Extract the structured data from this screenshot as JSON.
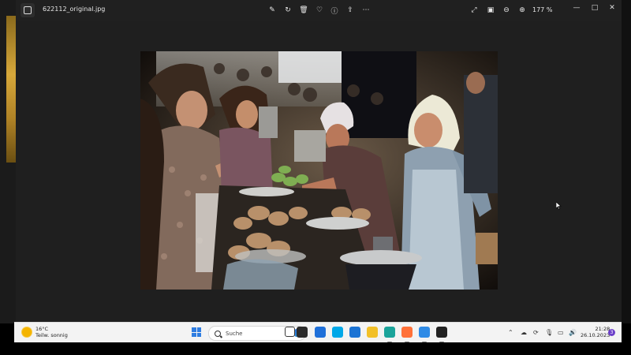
{
  "window": {
    "filename": "622112_original.jpg",
    "zoom": "177 %",
    "toolbar": [
      {
        "name": "edit-image-icon",
        "glyph": "✎"
      },
      {
        "name": "rotate-icon",
        "glyph": "↻"
      },
      {
        "name": "delete-icon",
        "glyph": "🗑"
      },
      {
        "name": "favorite-icon",
        "glyph": "♡"
      },
      {
        "name": "info-icon",
        "glyph": "ⓘ"
      },
      {
        "name": "share-icon",
        "glyph": "⇪"
      },
      {
        "name": "more-options-icon",
        "glyph": "⋯"
      }
    ],
    "viewer_controls": [
      {
        "name": "fullscreen-icon",
        "glyph": "⤢"
      },
      {
        "name": "fit-to-window-icon",
        "glyph": "▣"
      },
      {
        "name": "zoom-out-icon",
        "glyph": "⊖"
      },
      {
        "name": "zoom-in-icon",
        "glyph": "⊕"
      }
    ],
    "controls": {
      "minimize": "—",
      "maximize": "□",
      "close": "✕"
    }
  },
  "photo": {
    "subject": "market-scene-photo"
  },
  "taskbar": {
    "weather": {
      "temp": "16°C",
      "condition": "Teilw. sonnig"
    },
    "search_placeholder": "Suche",
    "apps": [
      {
        "name": "task-view-icon",
        "color": "#3a3a3a"
      },
      {
        "name": "file-manager-icon",
        "color": "#2b2b2b"
      },
      {
        "name": "store-icon",
        "color": "#1e6fd9"
      },
      {
        "name": "skype-icon",
        "color": "#00a8e8"
      },
      {
        "name": "mail-icon",
        "color": "#1b73d4"
      },
      {
        "name": "explorer-icon",
        "color": "#f2c028"
      },
      {
        "name": "edge-icon",
        "color": "#1aa39a"
      },
      {
        "name": "firefox-icon",
        "color": "#ff7139"
      },
      {
        "name": "photos-icon",
        "color": "#2f8be6"
      },
      {
        "name": "paint-icon",
        "color": "#222222"
      }
    ],
    "tray": [
      {
        "name": "chevron-up-icon",
        "glyph": "⌃"
      },
      {
        "name": "onedrive-icon",
        "glyph": "☁"
      },
      {
        "name": "sync-icon",
        "glyph": "⟳"
      },
      {
        "name": "microphone-icon",
        "glyph": "🎙"
      },
      {
        "name": "network-icon",
        "glyph": "▭"
      },
      {
        "name": "volume-icon",
        "glyph": "🔊"
      }
    ],
    "time": "21:28",
    "date": "26.10.2023",
    "notification_count": "3"
  }
}
